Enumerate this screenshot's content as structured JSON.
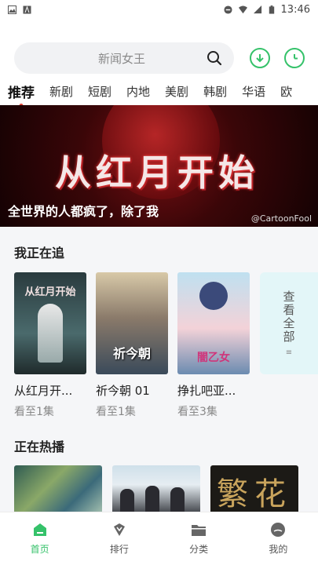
{
  "status_bar": {
    "time": "13:46"
  },
  "search": {
    "placeholder": "新闻女王"
  },
  "tabs": [
    {
      "label": "推荐",
      "active": true
    },
    {
      "label": "新剧"
    },
    {
      "label": "短剧"
    },
    {
      "label": "内地"
    },
    {
      "label": "美剧"
    },
    {
      "label": "韩剧"
    },
    {
      "label": "华语"
    },
    {
      "label": "欧"
    }
  ],
  "banner": {
    "logo_text": "从红月开始",
    "caption": "全世界的人都疯了，除了我",
    "credit": "@CartoonFool"
  },
  "following": {
    "title": "我正在追",
    "items": [
      {
        "title": "从红月开...",
        "progress": "看至1集",
        "poster_text": "从红月开始"
      },
      {
        "title": "祈今朝 01",
        "progress": "看至1集",
        "poster_text": "祈今朝"
      },
      {
        "title": "挣扎吧亚...",
        "progress": "看至3集",
        "poster_text": "闇乙女"
      }
    ],
    "view_all": "查看全部"
  },
  "hot": {
    "title": "正在热播",
    "thumb_text": "繁花"
  },
  "bottom_nav": [
    {
      "label": "首页",
      "icon": "home-icon",
      "active": true
    },
    {
      "label": "排行",
      "icon": "ranking-icon"
    },
    {
      "label": "分类",
      "icon": "folder-icon"
    },
    {
      "label": "我的",
      "icon": "profile-icon"
    }
  ],
  "colors": {
    "accent": "#35c26a",
    "dot": "#e0463a"
  }
}
